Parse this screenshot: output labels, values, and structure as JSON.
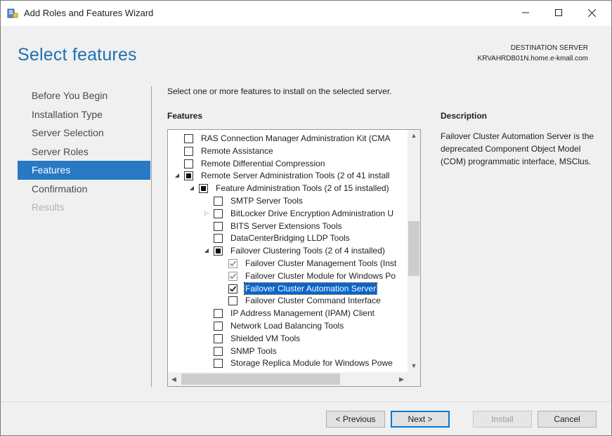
{
  "window": {
    "title": "Add Roles and Features Wizard"
  },
  "header": {
    "page_title": "Select features",
    "destination_label": "DESTINATION SERVER",
    "destination_server": "KRVAHRDB01N.home.e-kmall.com"
  },
  "nav": {
    "items": [
      {
        "label": "Before You Begin",
        "state": "normal"
      },
      {
        "label": "Installation Type",
        "state": "normal"
      },
      {
        "label": "Server Selection",
        "state": "normal"
      },
      {
        "label": "Server Roles",
        "state": "normal"
      },
      {
        "label": "Features",
        "state": "active"
      },
      {
        "label": "Confirmation",
        "state": "normal"
      },
      {
        "label": "Results",
        "state": "disabled"
      }
    ]
  },
  "main": {
    "instruction": "Select one or more features to install on the selected server.",
    "features_heading": "Features",
    "description_heading": "Description",
    "description_text": "Failover Cluster Automation Server is the deprecated Component Object Model (COM) programmatic interface, MSClus."
  },
  "tree": {
    "rows": [
      {
        "label": "RAS Connection Manager Administration Kit (CMA",
        "level": 0,
        "expander": "",
        "check": "unchecked"
      },
      {
        "label": "Remote Assistance",
        "level": 0,
        "expander": "",
        "check": "unchecked"
      },
      {
        "label": "Remote Differential Compression",
        "level": 0,
        "expander": "",
        "check": "unchecked"
      },
      {
        "label": "Remote Server Administration Tools (2 of 41 install",
        "level": 0,
        "expander": "expanded",
        "check": "partial"
      },
      {
        "label": "Feature Administration Tools (2 of 15 installed)",
        "level": 1,
        "expander": "expanded",
        "check": "partial"
      },
      {
        "label": "SMTP Server Tools",
        "level": 2,
        "expander": "",
        "check": "unchecked"
      },
      {
        "label": "BitLocker Drive Encryption Administration U",
        "level": 2,
        "expander": "collapsed",
        "check": "unchecked"
      },
      {
        "label": "BITS Server Extensions Tools",
        "level": 2,
        "expander": "",
        "check": "unchecked"
      },
      {
        "label": "DataCenterBridging LLDP Tools",
        "level": 2,
        "expander": "",
        "check": "unchecked"
      },
      {
        "label": "Failover Clustering Tools (2 of 4 installed)",
        "level": 2,
        "expander": "expanded",
        "check": "partial"
      },
      {
        "label": "Failover Cluster Management Tools (Inst",
        "level": 3,
        "expander": "",
        "check": "checked-installed"
      },
      {
        "label": "Failover Cluster Module for Windows Po",
        "level": 3,
        "expander": "",
        "check": "checked-installed"
      },
      {
        "label": "Failover Cluster Automation Server",
        "level": 3,
        "expander": "",
        "check": "checked",
        "selected": true
      },
      {
        "label": "Failover Cluster Command Interface",
        "level": 3,
        "expander": "",
        "check": "unchecked"
      },
      {
        "label": "IP Address Management (IPAM) Client",
        "level": 2,
        "expander": "",
        "check": "unchecked"
      },
      {
        "label": "Network Load Balancing Tools",
        "level": 2,
        "expander": "",
        "check": "unchecked"
      },
      {
        "label": "Shielded VM Tools",
        "level": 2,
        "expander": "",
        "check": "unchecked"
      },
      {
        "label": "SNMP Tools",
        "level": 2,
        "expander": "",
        "check": "unchecked"
      },
      {
        "label": "Storage Replica Module for Windows Powe",
        "level": 2,
        "expander": "",
        "check": "unchecked"
      }
    ]
  },
  "footer": {
    "previous_label": "< Previous",
    "next_label": "Next >",
    "install_label": "Install",
    "cancel_label": "Cancel"
  },
  "colors": {
    "accent": "#2779c4",
    "title_blue": "#1f6fb3",
    "selection": "#0a64c8"
  }
}
